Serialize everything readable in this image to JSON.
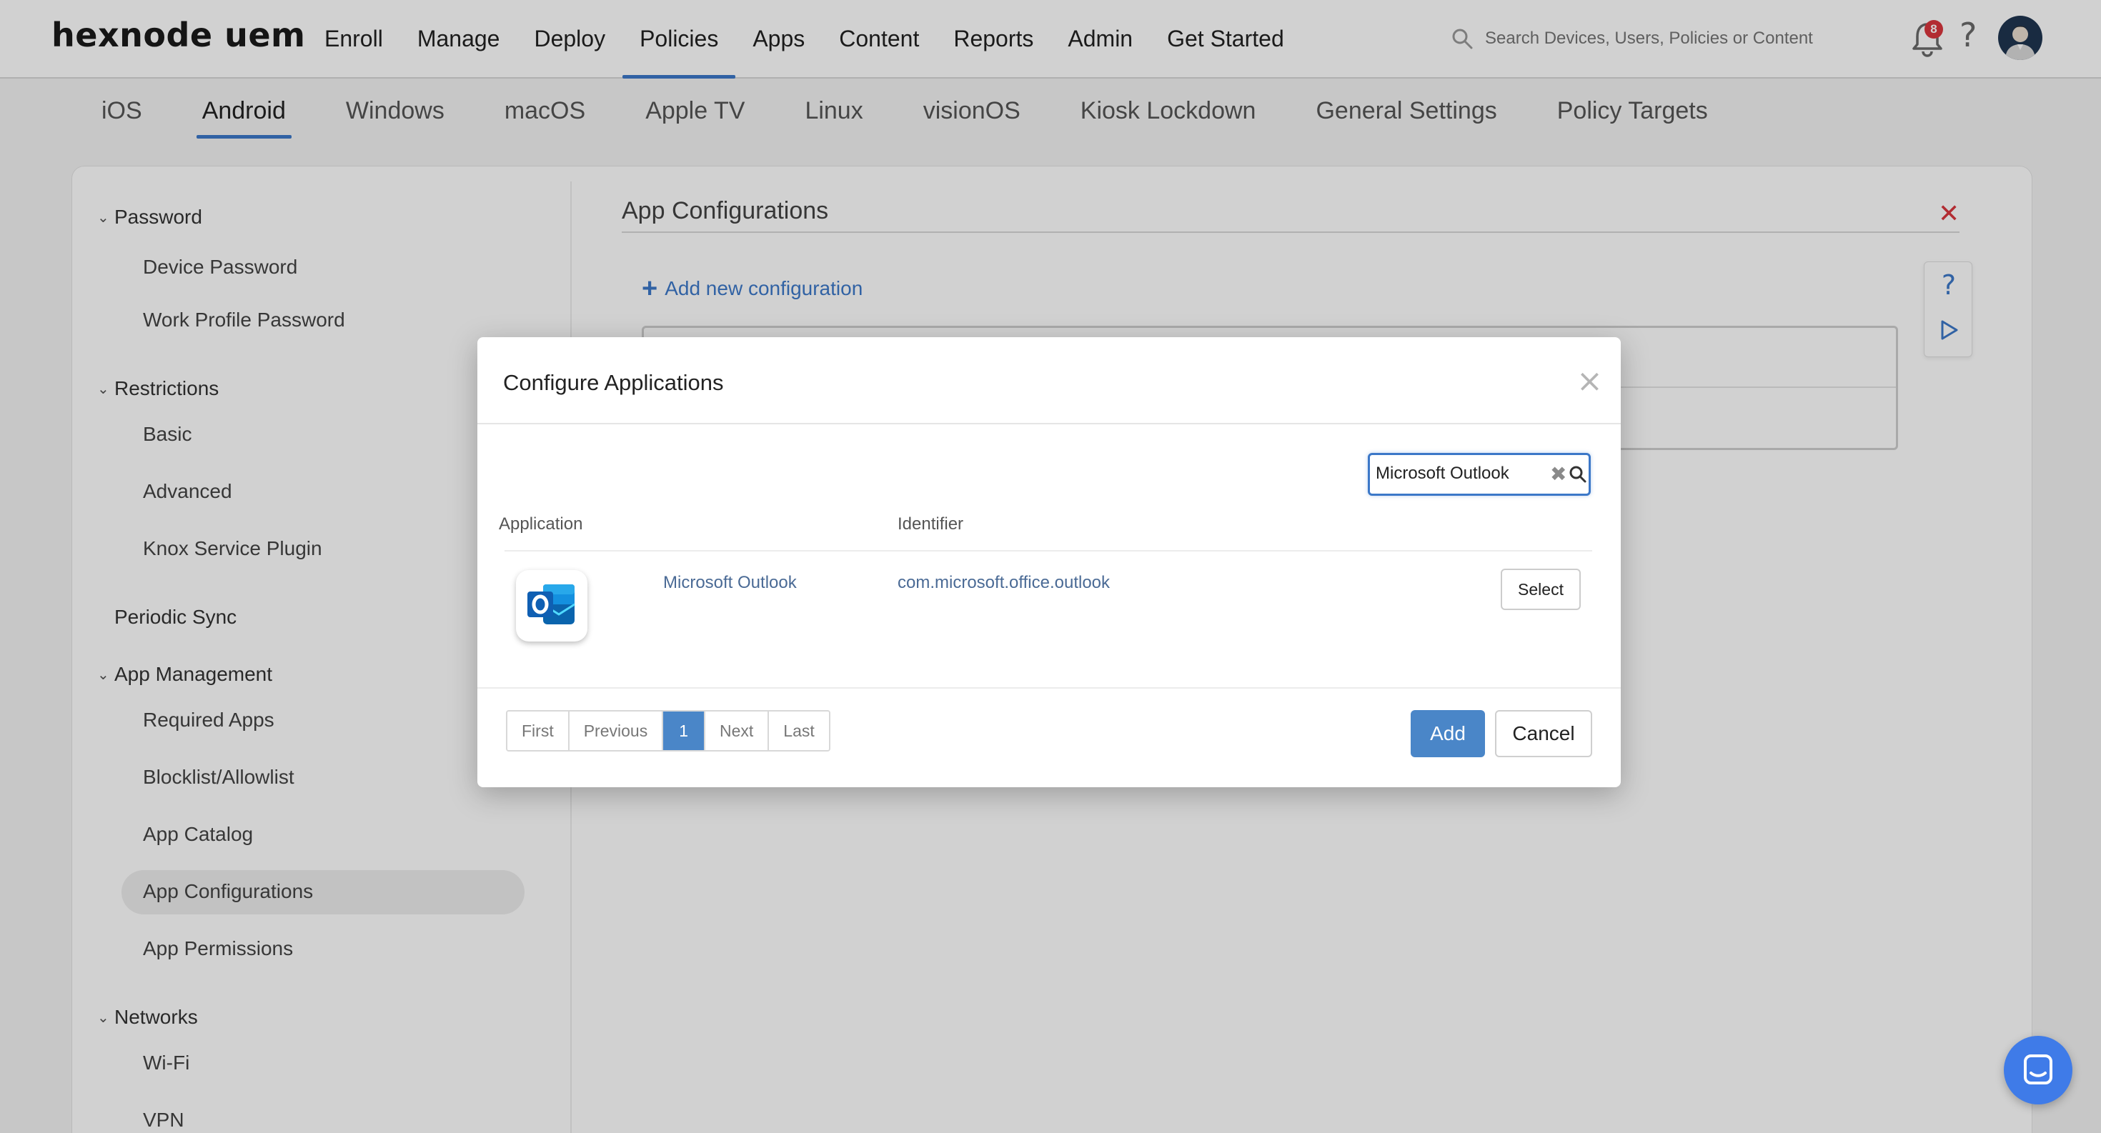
{
  "header": {
    "logo": "hexnode uem",
    "nav": [
      "Enroll",
      "Manage",
      "Deploy",
      "Policies",
      "Apps",
      "Content",
      "Reports",
      "Admin",
      "Get Started"
    ],
    "active_nav": "Policies",
    "search_placeholder": "Search Devices, Users, Policies or Content",
    "notification_count": "8",
    "help": "?"
  },
  "os_tabs": [
    "iOS",
    "Android",
    "Windows",
    "macOS",
    "Apple TV",
    "Linux",
    "visionOS",
    "Kiosk Lockdown",
    "General Settings",
    "Policy Targets"
  ],
  "active_os_tab": "Android",
  "sidebar": {
    "groups": [
      {
        "label": "Password",
        "items": [
          "Device Password",
          "Work Profile Password"
        ]
      },
      {
        "label": "Restrictions",
        "items": [
          "Basic",
          "Advanced",
          "Knox Service Plugin"
        ]
      },
      {
        "label": "Periodic Sync",
        "items": []
      },
      {
        "label": "App Management",
        "items": [
          "Required Apps",
          "Blocklist/Allowlist",
          "App Catalog",
          "App Configurations",
          "App Permissions"
        ]
      },
      {
        "label": "Networks",
        "items": [
          "Wi-Fi",
          "VPN"
        ]
      }
    ],
    "active_item": "App Configurations"
  },
  "panel": {
    "title": "App Configurations",
    "add_new": "Add new configuration"
  },
  "modal": {
    "title": "Configure Applications",
    "close": "×",
    "search_value": "Microsoft Outlook",
    "columns": [
      "Application",
      "Identifier"
    ],
    "rows": [
      {
        "name": "Microsoft Outlook",
        "identifier": "com.microsoft.office.outlook",
        "action": "Select"
      }
    ],
    "pagination": [
      "First",
      "Previous",
      "1",
      "Next",
      "Last"
    ],
    "current_page": "1",
    "add_label": "Add",
    "cancel_label": "Cancel"
  },
  "colors": {
    "accent": "#3c78c8",
    "primary_button": "#4a86c8",
    "danger": "#d9363e",
    "chat": "#3f7be8"
  }
}
